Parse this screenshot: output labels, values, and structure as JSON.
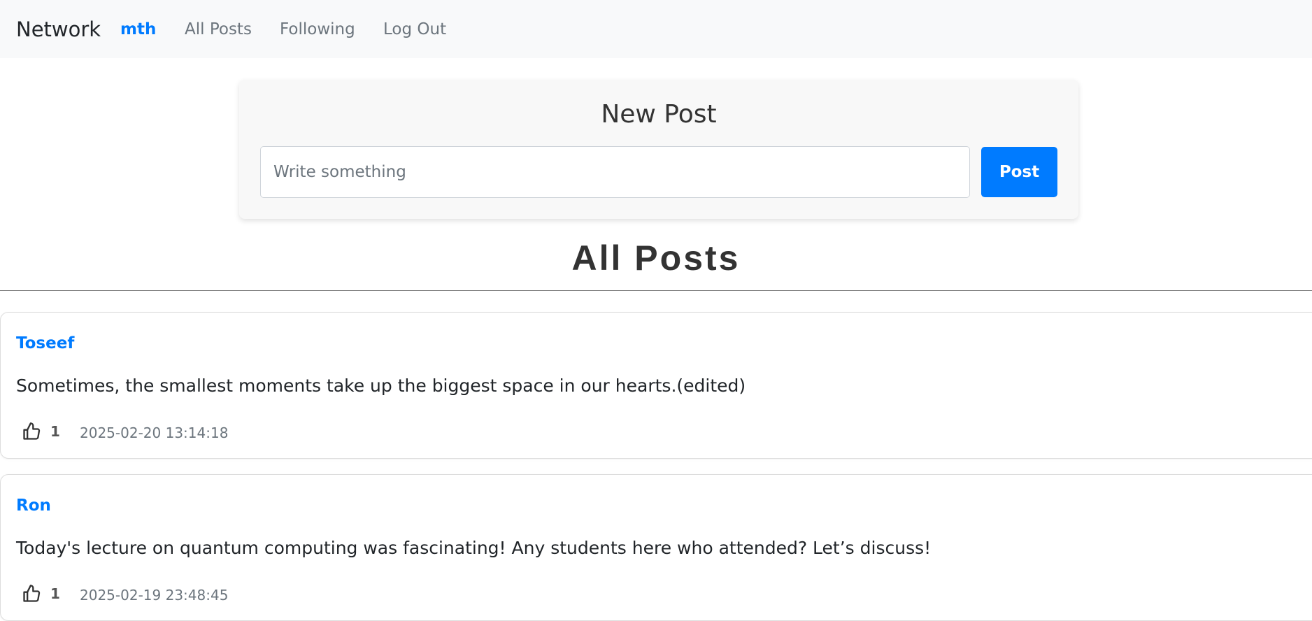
{
  "navbar": {
    "brand": "Network",
    "user": "mth",
    "links": {
      "all_posts": "All Posts",
      "following": "Following",
      "log_out": "Log Out"
    }
  },
  "new_post": {
    "title": "New Post",
    "placeholder": "Write something",
    "button_label": "Post"
  },
  "feed": {
    "heading": "All Posts",
    "posts": [
      {
        "author": "Toseef",
        "content": "Sometimes, the smallest moments take up the biggest space in our hearts.(edited)",
        "likes": "1",
        "timestamp": "2025-02-20 13:14:18",
        "icon": "thumbs-up-icon"
      },
      {
        "author": "Ron",
        "content": "Today's lecture on quantum computing was fascinating! Any students here who attended? Let’s discuss!",
        "likes": "1",
        "timestamp": "2025-02-19 23:48:45",
        "icon": "thumbs-up-icon"
      }
    ]
  },
  "colors": {
    "accent": "#007bff",
    "navbar_bg": "#f8f9fa",
    "card_bg": "#f8f8f8"
  }
}
